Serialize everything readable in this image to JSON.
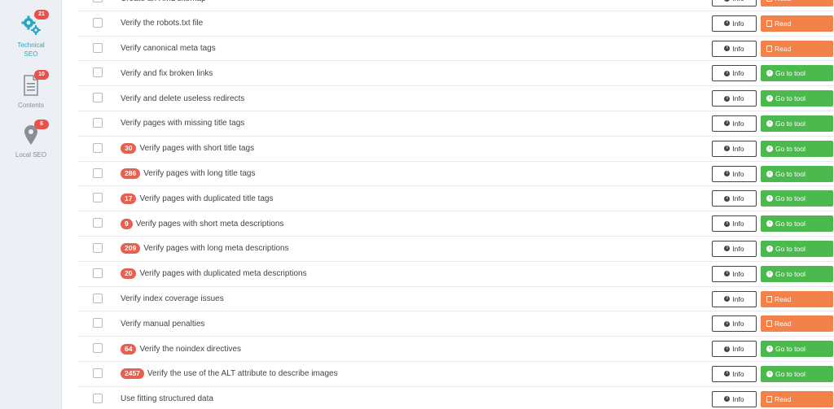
{
  "sidebar": {
    "items": [
      {
        "label": "Technical SEO",
        "badge": "21",
        "icon": "gears-icon",
        "active": true
      },
      {
        "label": "Contents",
        "badge": "10",
        "icon": "document-icon",
        "active": false
      },
      {
        "label": "Local SEO",
        "badge": "6",
        "icon": "map-pin-icon",
        "active": false
      }
    ]
  },
  "buttons": {
    "info_label": "Info",
    "read_label": "Read",
    "tool_label": "Go to tool"
  },
  "colors": {
    "read": "#f2824a",
    "tool": "#4cb94f",
    "badge": "#e8604f",
    "active_nav": "#25a8c4"
  },
  "tasks": [
    {
      "count": "",
      "label": "Create an XML sitemap",
      "action": "read"
    },
    {
      "count": "",
      "label": "Verify the robots.txt file",
      "action": "read"
    },
    {
      "count": "",
      "label": "Verify canonical meta tags",
      "action": "read"
    },
    {
      "count": "",
      "label": "Verify and fix broken links",
      "action": "tool"
    },
    {
      "count": "",
      "label": "Verify and delete useless redirects",
      "action": "tool"
    },
    {
      "count": "",
      "label": "Verify pages with missing title tags",
      "action": "tool"
    },
    {
      "count": "30",
      "label": "Verify pages with short title tags",
      "action": "tool"
    },
    {
      "count": "286",
      "label": "Verify pages with long title tags",
      "action": "tool"
    },
    {
      "count": "17",
      "label": "Verify pages with duplicated title tags",
      "action": "tool"
    },
    {
      "count": "9",
      "label": "Verify pages with short meta descriptions",
      "action": "tool"
    },
    {
      "count": "209",
      "label": "Verify pages with long meta descriptions",
      "action": "tool"
    },
    {
      "count": "20",
      "label": "Verify pages with duplicated meta descriptions",
      "action": "tool"
    },
    {
      "count": "",
      "label": "Verify index coverage issues",
      "action": "read"
    },
    {
      "count": "",
      "label": "Verify manual penalties",
      "action": "read"
    },
    {
      "count": "64",
      "label": "Verify the noindex directives",
      "action": "tool"
    },
    {
      "count": "2457",
      "label": "Verify the use of the ALT attribute to describe images",
      "action": "tool"
    },
    {
      "count": "",
      "label": "Use fitting structured data",
      "action": "read"
    }
  ]
}
